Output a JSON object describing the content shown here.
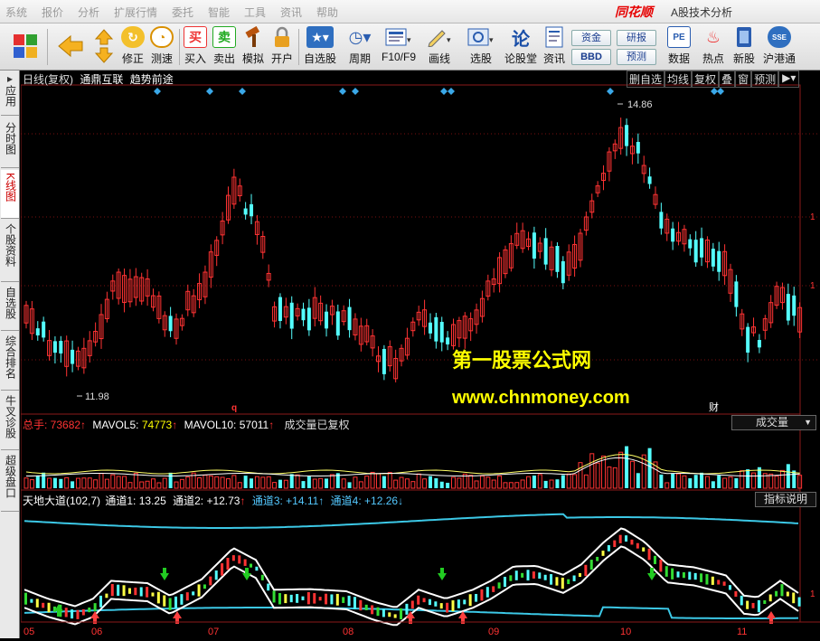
{
  "menu": [
    "系统",
    "报价",
    "分析",
    "扩展行情",
    "委托",
    "智能",
    "工具",
    "资讯",
    "帮助"
  ],
  "brand": "同花顺",
  "brand_subtitle": "A股技术分析",
  "toolbar": {
    "buttons": [
      {
        "label": "",
        "icon": "grid-icon"
      },
      {
        "label": "",
        "icon": "back-arrow-icon"
      },
      {
        "label": "修正",
        "icon": "correct-icon"
      },
      {
        "label": "测速",
        "icon": "speed-icon"
      },
      {
        "label": "买入",
        "icon": "buy-icon",
        "icon_text": "买"
      },
      {
        "label": "卖出",
        "icon": "sell-icon",
        "icon_text": "卖"
      },
      {
        "label": "模拟",
        "icon": "hammer-icon"
      },
      {
        "label": "开户",
        "icon": "lock-icon"
      },
      {
        "label": "自选股",
        "icon": "watchlist-icon"
      },
      {
        "label": "周期",
        "icon": "clock-icon"
      },
      {
        "label": "F10/F9",
        "icon": "f10-icon"
      },
      {
        "label": "画线",
        "icon": "pen-icon"
      },
      {
        "label": "选股",
        "icon": "stock-pick-icon"
      },
      {
        "label": "论股堂",
        "icon": "forum-icon",
        "icon_text": "论"
      },
      {
        "label": "资讯",
        "icon": "news-icon"
      },
      {
        "label": "数据",
        "icon": "pe-icon",
        "icon_text": "PE"
      },
      {
        "label": "热点",
        "icon": "hot-icon"
      },
      {
        "label": "新股",
        "icon": "new-stock-icon"
      },
      {
        "label": "沪港通",
        "icon": "hk-connect-icon"
      }
    ],
    "mini_buttons": [
      "资金",
      "BBD",
      "研报",
      "预测"
    ]
  },
  "left_tabs": [
    "应用",
    "分时图",
    "K线图",
    "个股资料",
    "自选股",
    "综合排名",
    "牛叉诊股",
    "超级盘口"
  ],
  "chart_header": {
    "period": "日线(复权)",
    "stock_name": "通鼎互联",
    "indicator_name": "趋势前途",
    "buttons": [
      "删自选",
      "均线",
      "复权",
      "叠",
      "窗",
      "预测"
    ]
  },
  "price_labels": {
    "high": "14.86",
    "low": "11.98"
  },
  "markers": {
    "q": "q",
    "cai": "财"
  },
  "watermark": {
    "line1": "第一股票公式网",
    "line2": "www.chnmoney.com"
  },
  "volume_header": {
    "total_label": "总手: ",
    "total_value": "73682",
    "mavol5_label": "MAVOL5: ",
    "mavol5_value": "74773",
    "mavol10_label": "MAVOL10: ",
    "mavol10_value": "57011",
    "status": "成交量已复权",
    "selector": "成交量"
  },
  "indicator_header": {
    "name": "天地大道(102,7)",
    "ch1_label": "通道1: ",
    "ch1": "13.25",
    "ch2_label": "通道2: ",
    "ch2": "+12.73",
    "ch3_label": "通道3: ",
    "ch3": "+14.11",
    "ch4_label": "通道4: ",
    "ch4": "+12.26",
    "help_button": "指标说明"
  },
  "x_axis": [
    "05",
    "06",
    "07",
    "08",
    "09",
    "10",
    "11"
  ],
  "colors": {
    "up": "#ff3333",
    "down": "#54ffff",
    "channel_outer": "#3cc8e6",
    "channel_inner": "#ffffff",
    "buy_arrow": "#ff4040",
    "sell_arrow": "#22cc22",
    "watermark": "#ffff00"
  }
}
